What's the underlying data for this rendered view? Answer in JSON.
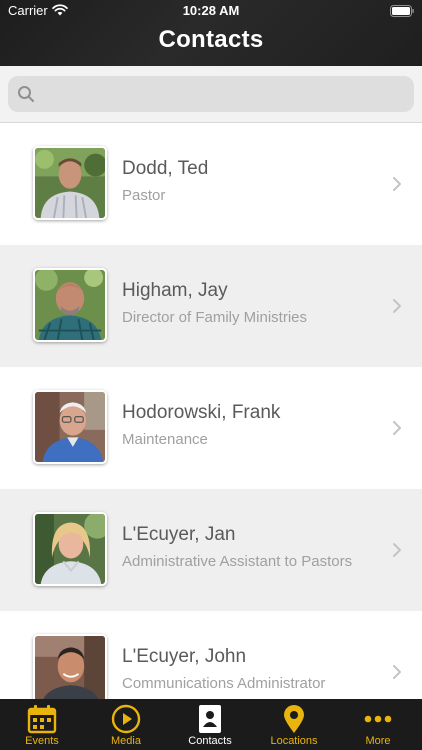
{
  "status_bar": {
    "carrier": "Carrier",
    "time": "10:28 AM"
  },
  "header": {
    "title": "Contacts"
  },
  "search": {
    "placeholder": ""
  },
  "contacts": [
    {
      "name": "Dodd, Ted",
      "role": "Pastor"
    },
    {
      "name": "Higham, Jay",
      "role": "Director of Family Ministries"
    },
    {
      "name": "Hodorowski, Frank",
      "role": "Maintenance"
    },
    {
      "name": "L'Ecuyer, Jan",
      "role": "Administrative Assistant to Pastors"
    },
    {
      "name": "L'Ecuyer, John",
      "role": "Communications Administrator"
    }
  ],
  "tabs": [
    {
      "label": "Events",
      "icon": "calendar-icon"
    },
    {
      "label": "Media",
      "icon": "play-icon"
    },
    {
      "label": "Contacts",
      "icon": "contact-card-icon",
      "active": true
    },
    {
      "label": "Locations",
      "icon": "map-pin-icon"
    },
    {
      "label": "More",
      "icon": "more-dots-icon"
    }
  ],
  "colors": {
    "accent": "#e8b40d",
    "header_bg": "#1f1f1f",
    "alt_row": "#efefef"
  }
}
